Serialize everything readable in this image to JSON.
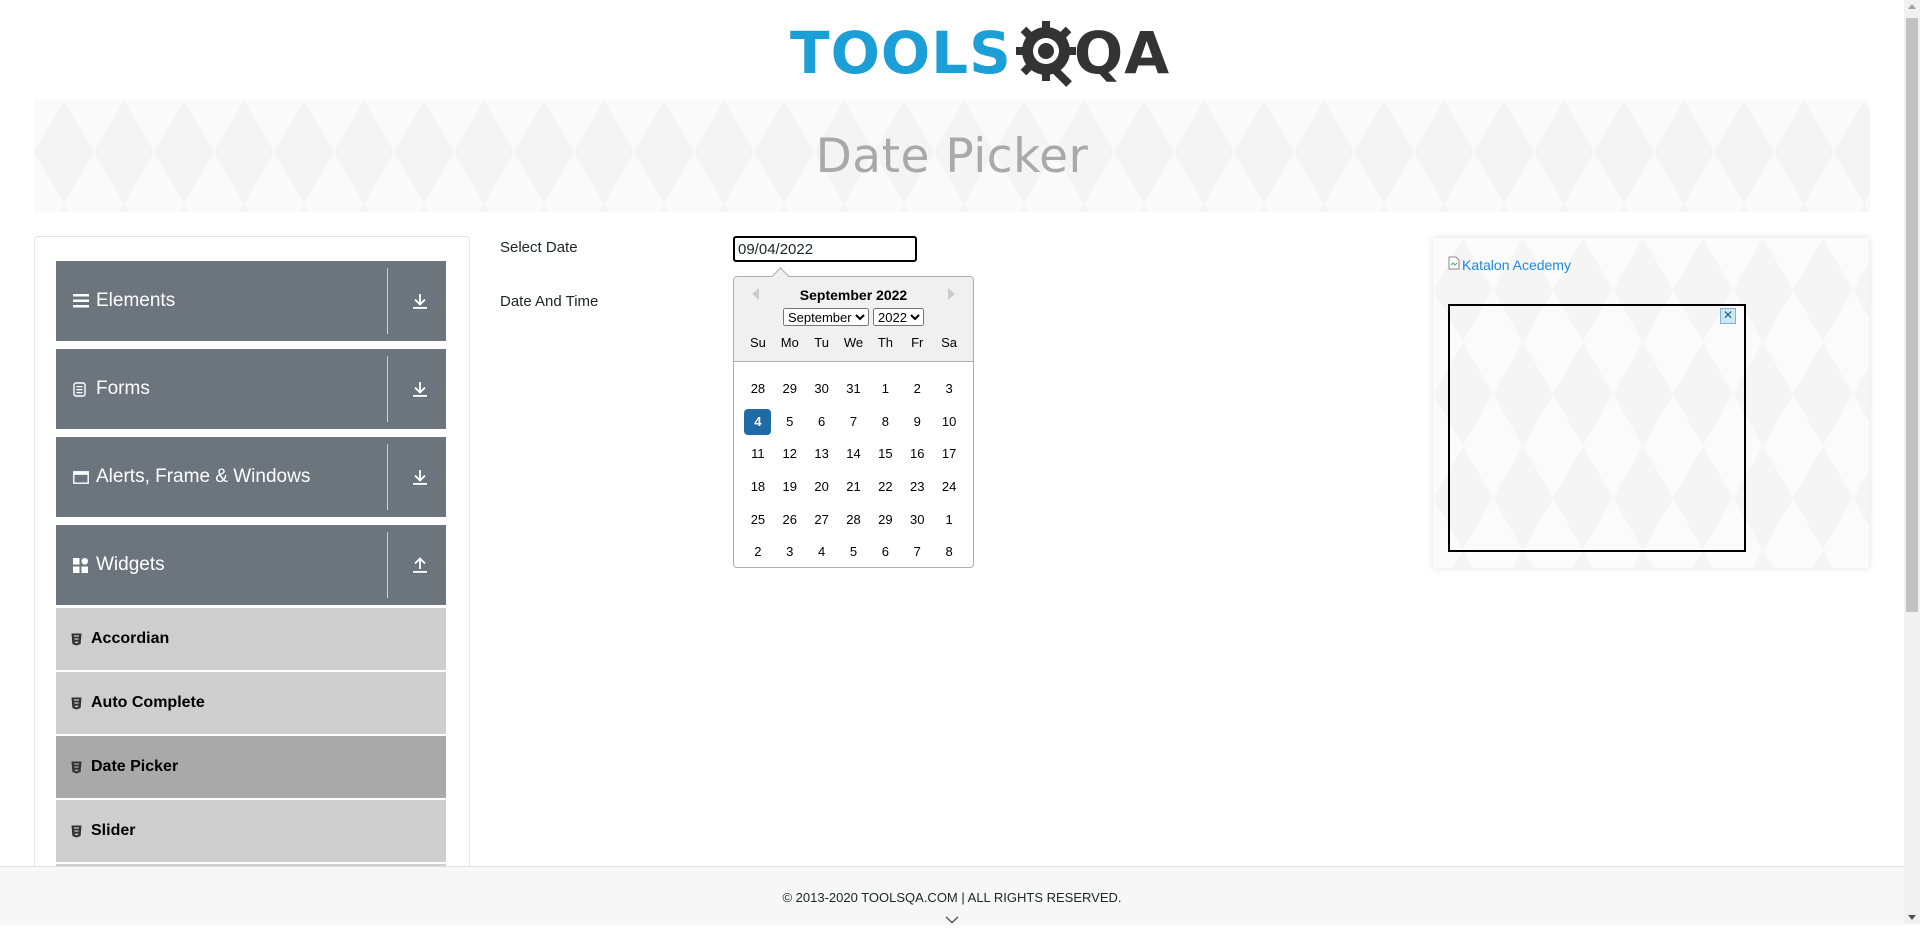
{
  "logo": {
    "part1": "TOOLS",
    "part2": "QA"
  },
  "page_title": "Date Picker",
  "sidebar": {
    "groups": [
      {
        "label": "Elements",
        "icon": "hamburger-icon",
        "toggle": "download-arrow-icon"
      },
      {
        "label": "Forms",
        "icon": "document-icon",
        "toggle": "download-arrow-icon"
      },
      {
        "label": "Alerts, Frame & Windows",
        "icon": "window-icon",
        "toggle": "download-arrow-icon"
      },
      {
        "label": "Widgets",
        "icon": "grid-icon",
        "toggle": "upload-arrow-icon"
      }
    ],
    "items": [
      {
        "label": "Accordian"
      },
      {
        "label": "Auto Complete"
      },
      {
        "label": "Date Picker",
        "active": true
      },
      {
        "label": "Slider"
      }
    ]
  },
  "form": {
    "select_date_label": "Select Date",
    "select_date_value": "09/04/2022",
    "date_time_label": "Date And Time"
  },
  "calendar": {
    "title": "September 2022",
    "month_selected": "September",
    "year_selected": "2022",
    "weekdays": [
      "Su",
      "Mo",
      "Tu",
      "We",
      "Th",
      "Fr",
      "Sa"
    ],
    "weeks": [
      [
        "28",
        "29",
        "30",
        "31",
        "1",
        "2",
        "3"
      ],
      [
        "4",
        "5",
        "6",
        "7",
        "8",
        "9",
        "10"
      ],
      [
        "11",
        "12",
        "13",
        "14",
        "15",
        "16",
        "17"
      ],
      [
        "18",
        "19",
        "20",
        "21",
        "22",
        "23",
        "24"
      ],
      [
        "25",
        "26",
        "27",
        "28",
        "29",
        "30",
        "1"
      ],
      [
        "2",
        "3",
        "4",
        "5",
        "6",
        "7",
        "8"
      ]
    ],
    "selected_day": "4",
    "accent_color": "#216ba5"
  },
  "ad": {
    "link_text": "Katalon Acedemy",
    "close_glyph": "✕"
  },
  "footer": {
    "text": "© 2013-2020 TOOLSQA.COM | ALL RIGHTS RESERVED."
  },
  "colors": {
    "sidebar_group": "#6c757d",
    "sidebar_item": "#cecece",
    "sidebar_item_active": "#a9a9a9",
    "logo_blue": "#1c9fd6"
  }
}
